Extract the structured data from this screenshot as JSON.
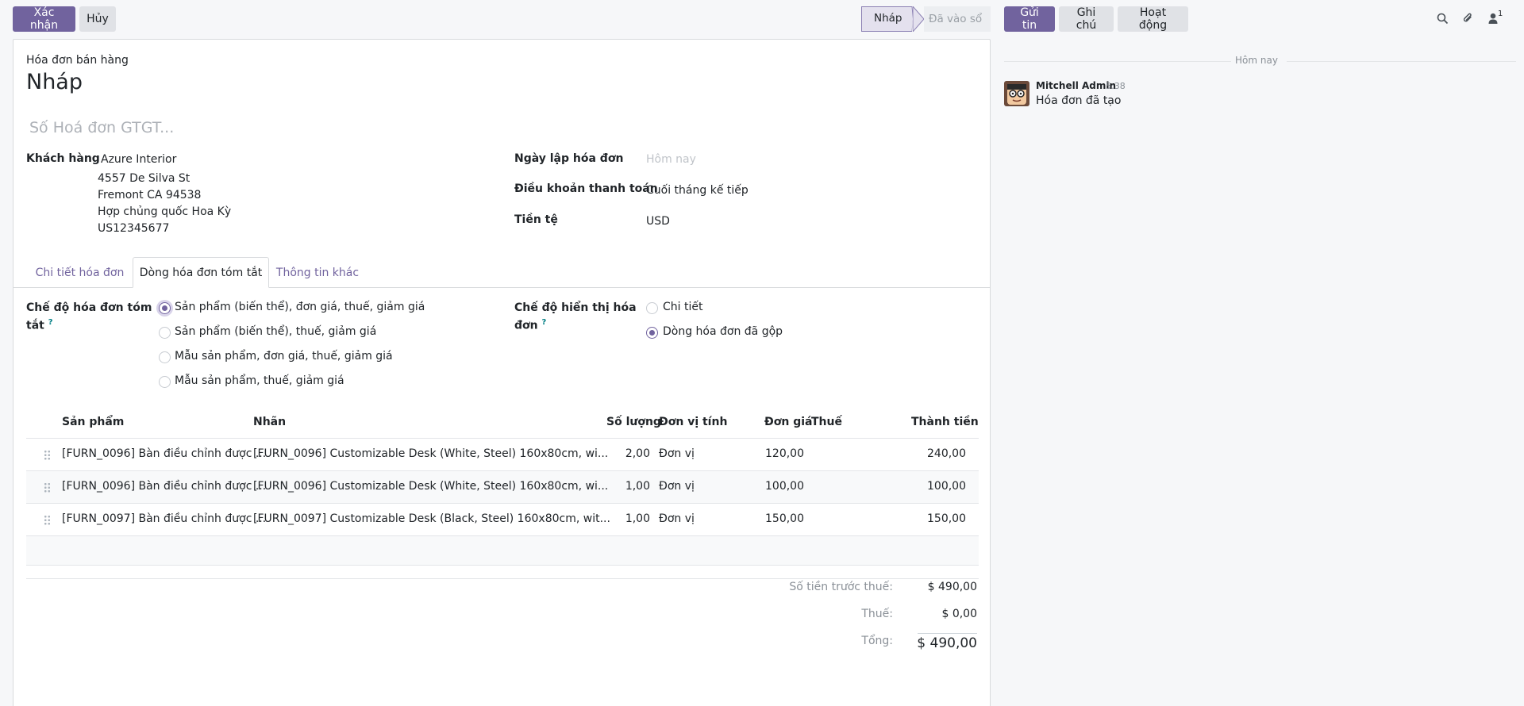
{
  "control_panel": {
    "confirm_label": "Xác nhận",
    "cancel_label": "Hủy",
    "status": [
      "Nháp",
      "Đã vào sổ"
    ]
  },
  "chatter": {
    "send_label": "Gửi tin",
    "note_label": "Ghi chú",
    "activity_label": "Hoạt động",
    "follower_count": "1",
    "date_separator": "Hôm nay",
    "message": {
      "author": "Mitchell Admin",
      "time": "5:38",
      "body": "Hóa đơn đã tạo"
    }
  },
  "form": {
    "doc_type": "Hóa đơn bán hàng",
    "name": "Nháp",
    "vat_placeholder": "Số Hoá đơn GTGT...",
    "customer_label": "Khách hàng",
    "customer": {
      "name": "Azure Interior",
      "street": "4557 De Silva St",
      "city": "Fremont CA 94538",
      "country": "Hợp chủng quốc Hoa Kỳ",
      "vat": "US12345677"
    },
    "invoice_date_label": "Ngày lập hóa đơn",
    "invoice_date_placeholder": "Hôm nay",
    "payment_term_label": "Điều khoản thanh toán",
    "payment_term": "Cuối tháng kế tiếp",
    "currency_label": "Tiền tệ",
    "currency": "USD",
    "tabs": [
      "Chi tiết hóa đơn",
      "Dòng hóa đơn tóm tắt",
      "Thông tin khác"
    ],
    "summary_mode_label_1": "Chế độ hóa đơn tóm",
    "summary_mode_label_2": "tắt",
    "summary_options": [
      "Sản phẩm (biến thể), đơn giá, thuế, giảm giá",
      "Sản phẩm (biến thể), thuế, giảm giá",
      "Mẫu sản phẩm, đơn giá, thuế, giảm giá",
      "Mẫu sản phẩm, thuế, giảm giá"
    ],
    "display_mode_label_1": "Chế độ hiển thị hóa",
    "display_mode_label_2": "đơn",
    "display_options": [
      "Chi tiết",
      "Dòng hóa đơn đã gộp"
    ],
    "help_mark": "?",
    "columns": [
      "Sản phẩm",
      "Nhãn",
      "Số lượng",
      "Đơn vị tính",
      "Đơn giá",
      "Thuế",
      "Thành tiền"
    ],
    "lines": [
      {
        "product": "[FURN_0096] Bàn điều chỉnh được ...",
        "label": "[FURN_0096] Customizable Desk (White, Steel) 160x80cm, wi...",
        "qty": "2,00",
        "uom": "Đơn vị",
        "price": "120,00",
        "tax": "",
        "subtotal": "240,00"
      },
      {
        "product": "[FURN_0096] Bàn điều chỉnh được ...",
        "label": "[FURN_0096] Customizable Desk (White, Steel) 160x80cm, wi...",
        "qty": "1,00",
        "uom": "Đơn vị",
        "price": "100,00",
        "tax": "",
        "subtotal": "100,00"
      },
      {
        "product": "[FURN_0097] Bàn điều chỉnh được ...",
        "label": "[FURN_0097] Customizable Desk (Black, Steel) 160x80cm, wit...",
        "qty": "1,00",
        "uom": "Đơn vị",
        "price": "150,00",
        "tax": "",
        "subtotal": "150,00"
      }
    ],
    "totals": {
      "untaxed_label": "Số tiền trước thuế:",
      "untaxed": "$ 490,00",
      "tax_label": "Thuế:",
      "tax": "$ 0,00",
      "total_label": "Tổng:",
      "total": "$ 490,00"
    }
  },
  "colors": {
    "primary": "#71639e",
    "secondary_btn": "#e0e2e6",
    "link": "#71639e"
  },
  "icons": [
    "search-icon",
    "paperclip-icon",
    "user-icon",
    "drag-handle-icon"
  ]
}
